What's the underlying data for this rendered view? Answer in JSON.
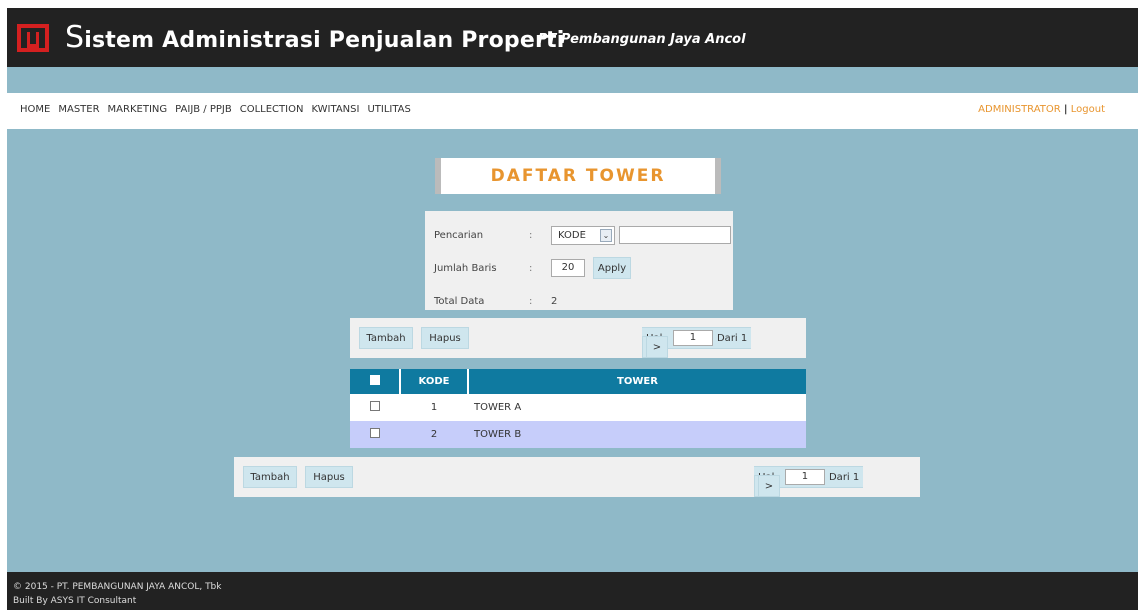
{
  "header": {
    "title_initial": "S",
    "title_rest": "istem Administrasi Penjualan Properti",
    "company": "PT Pembangunan Jaya Ancol"
  },
  "nav": {
    "items": [
      "HOME",
      "MASTER",
      "MARKETING",
      "PAIJB / PPJB",
      "COLLECTION",
      "KWITANSI",
      "UTILITAS"
    ],
    "user": "ADMINISTRATOR",
    "separator": "|",
    "logout": "Logout"
  },
  "page": {
    "title": "DAFTAR TOWER"
  },
  "search": {
    "pencarian_label": "Pencarian",
    "colon": ":",
    "field_select": "KODE",
    "search_value": "",
    "jumlah_label": "Jumlah Baris",
    "jumlah_value": "20",
    "apply_label": "Apply",
    "total_label": "Total Data",
    "total_value": "2"
  },
  "toolbar": {
    "tambah_label": "Tambah",
    "hapus_label": "Hapus",
    "prev_label": "<",
    "next_label": ">",
    "hal_label": "Hal :",
    "page_value": "1",
    "dari_label": "Dari 1"
  },
  "table": {
    "headers": {
      "kode": "KODE",
      "tower": "TOWER"
    },
    "rows": [
      {
        "kode": "1",
        "tower": "TOWER A"
      },
      {
        "kode": "2",
        "tower": "TOWER B"
      }
    ]
  },
  "footer": {
    "copyright": "© 2015 - PT. PEMBANGUNAN JAYA ANCOL, Tbk",
    "built_by": "Built By ASYS IT Consultant"
  },
  "colors": {
    "background": "#8fb9c8",
    "header": "#222222",
    "accent": "#e8952f",
    "table_header": "#0f7aa0",
    "button": "#cfe6ee",
    "selected_row": "#c6cdfa"
  }
}
